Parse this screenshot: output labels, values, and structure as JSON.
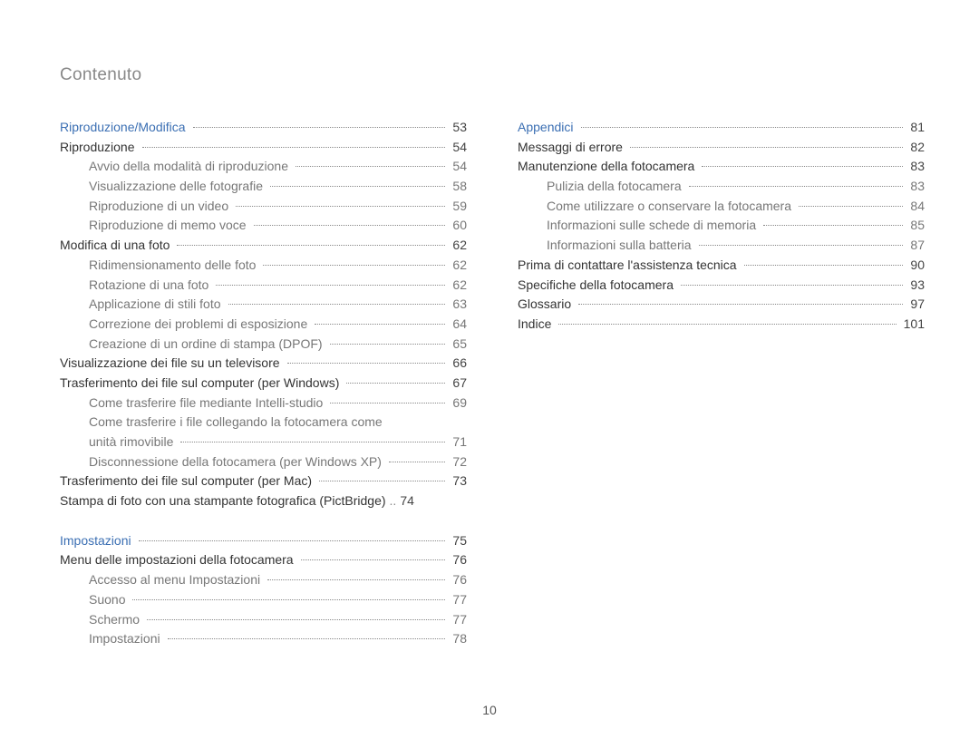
{
  "header": {
    "title": "Contenuto"
  },
  "page_number": "10",
  "columns": [
    {
      "sections": [
        {
          "entries": [
            {
              "level": 0,
              "label": "Riproduzione/Modifica",
              "page": "53"
            },
            {
              "level": 1,
              "label": "Riproduzione",
              "page": "54"
            },
            {
              "level": 2,
              "label": "Avvio della modalità di riproduzione",
              "page": "54"
            },
            {
              "level": 2,
              "label": "Visualizzazione delle fotografie",
              "page": "58"
            },
            {
              "level": 2,
              "label": "Riproduzione di un video",
              "page": "59"
            },
            {
              "level": 2,
              "label": "Riproduzione di memo voce",
              "page": "60"
            },
            {
              "level": 1,
              "label": "Modifica di una foto",
              "page": "62"
            },
            {
              "level": 2,
              "label": "Ridimensionamento delle foto",
              "page": "62"
            },
            {
              "level": 2,
              "label": "Rotazione di una foto",
              "page": "62"
            },
            {
              "level": 2,
              "label": "Applicazione di stili foto",
              "page": "63"
            },
            {
              "level": 2,
              "label": "Correzione dei problemi di esposizione",
              "page": "64"
            },
            {
              "level": 2,
              "label": "Creazione di un ordine di stampa (DPOF)",
              "page": "65"
            },
            {
              "level": 1,
              "label": "Visualizzazione dei file su un televisore",
              "page": "66"
            },
            {
              "level": 1,
              "label": "Trasferimento dei file sul computer (per Windows)",
              "page": "67"
            },
            {
              "level": 2,
              "label": "Come trasferire file mediante Intelli-studio",
              "page": "69"
            },
            {
              "level": 2,
              "wrap_first": "Come trasferire i file collegando la fotocamera come",
              "wrap_rest": "unità rimovibile",
              "page": "71"
            },
            {
              "level": 2,
              "label": "Disconnessione della fotocamera (per Windows XP)",
              "page": "72"
            },
            {
              "level": 1,
              "label": "Trasferimento dei file sul computer (per Mac)",
              "page": "73"
            },
            {
              "level": 1,
              "label": "Stampa di foto con una stampante fotografica (PictBridge)",
              "page": "74",
              "tight": true
            }
          ]
        },
        {
          "gap": true,
          "entries": [
            {
              "level": 0,
              "label": "Impostazioni",
              "page": "75"
            },
            {
              "level": 1,
              "label": "Menu delle impostazioni della fotocamera",
              "page": "76"
            },
            {
              "level": 2,
              "label": "Accesso al menu Impostazioni",
              "page": "76"
            },
            {
              "level": 2,
              "label": "Suono",
              "page": "77"
            },
            {
              "level": 2,
              "label": "Schermo",
              "page": "77"
            },
            {
              "level": 2,
              "label": "Impostazioni",
              "page": "78"
            }
          ]
        }
      ]
    },
    {
      "sections": [
        {
          "entries": [
            {
              "level": 0,
              "label": "Appendici",
              "page": "81"
            },
            {
              "level": 1,
              "label": "Messaggi di errore",
              "page": "82"
            },
            {
              "level": 1,
              "label": "Manutenzione della fotocamera",
              "page": "83"
            },
            {
              "level": 2,
              "label": "Pulizia della fotocamera",
              "page": "83"
            },
            {
              "level": 2,
              "label": "Come utilizzare o conservare la fotocamera",
              "page": "84"
            },
            {
              "level": 2,
              "label": "Informazioni sulle schede di memoria",
              "page": "85"
            },
            {
              "level": 2,
              "label": "Informazioni sulla batteria",
              "page": "87"
            },
            {
              "level": 1,
              "label": "Prima di contattare l'assistenza tecnica",
              "page": "90"
            },
            {
              "level": 1,
              "label": "Specifiche della fotocamera",
              "page": "93"
            },
            {
              "level": 1,
              "label": "Glossario",
              "page": "97"
            },
            {
              "level": 1,
              "label": "Indice",
              "page": "101"
            }
          ]
        }
      ]
    }
  ]
}
